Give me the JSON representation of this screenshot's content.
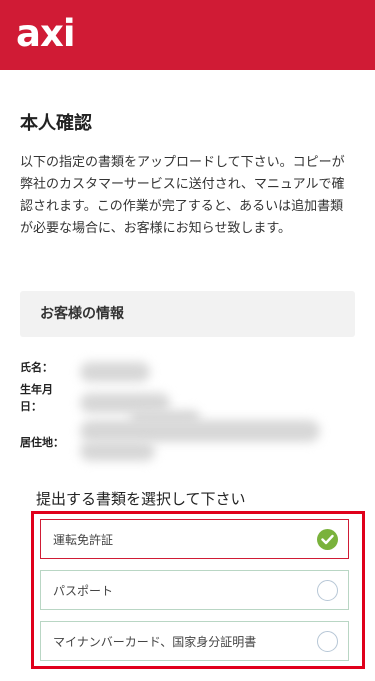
{
  "header": {
    "logo_text": "axi",
    "background": "#d01b35"
  },
  "page": {
    "title": "本人確認",
    "intro": "以下の指定の書類をアップロードして下さい。コピーが弊社のカスタマーサービスに送付され、マニュアルで確認されます。この作業が完了すると、あるいは追加書類が必要な場合に、お客様にお知らせ致します。"
  },
  "customer_info": {
    "title": "お客様の情報",
    "fields": [
      {
        "label": "氏名："
      },
      {
        "label": "生年月日："
      },
      {
        "label": "居住地："
      }
    ]
  },
  "documents": {
    "title": "提出する書類を選択して下さい",
    "options": [
      {
        "label": "運転免許証",
        "selected": true,
        "icon": "check-circle-icon"
      },
      {
        "label": "パスポート",
        "selected": false,
        "icon": "radio-empty-icon"
      },
      {
        "label": "マイナンバーカード、国家身分証明書",
        "selected": false,
        "icon": "radio-empty-icon"
      }
    ],
    "highlight_color": "#e0001b",
    "check_color": "#7ab23c"
  }
}
